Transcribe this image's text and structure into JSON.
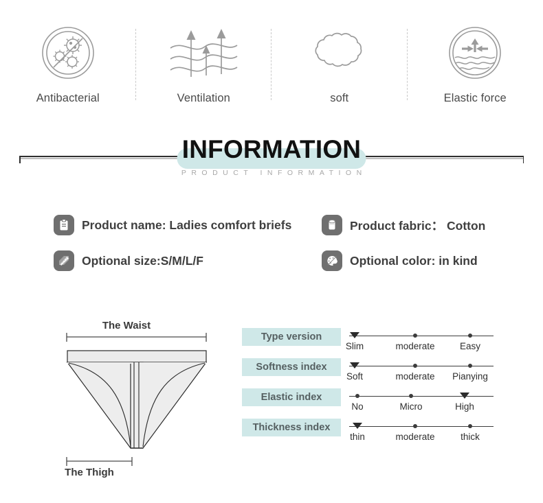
{
  "features": [
    {
      "label": "Antibacterial",
      "icon": "antibacterial-icon"
    },
    {
      "label": "Ventilation",
      "icon": "ventilation-icon"
    },
    {
      "label": "soft",
      "icon": "soft-cloud-icon"
    },
    {
      "label": "Elastic force",
      "icon": "elastic-force-icon"
    }
  ],
  "banner": {
    "title": "INFORMATION",
    "subtitle": "PRODUCT INFORMATION",
    "pill_color": "#cfe8e8"
  },
  "info": [
    {
      "icon": "clipboard-icon",
      "text": "Product name: Ladies comfort briefs"
    },
    {
      "icon": "ruler-icon",
      "text": "Optional size:S/M/L/F"
    },
    {
      "icon": "fabric-icon",
      "text": "Product fabric： Cotton"
    },
    {
      "icon": "palette-icon",
      "text": "Optional color: in kind"
    }
  ],
  "garment": {
    "waist_label": "The  Waist",
    "thigh_label": "The Thigh"
  },
  "scales": {
    "label_color": "#cfe8e8",
    "rows": [
      {
        "label": "Type version",
        "points": [
          {
            "label": "Slim",
            "marker": "triangle"
          },
          {
            "label": "moderate",
            "marker": "dot"
          },
          {
            "label": "Easy",
            "marker": "dot"
          }
        ]
      },
      {
        "label": "Softness index",
        "points": [
          {
            "label": "Soft",
            "marker": "triangle"
          },
          {
            "label": "moderate",
            "marker": "dot"
          },
          {
            "label": "Pianying",
            "marker": "dot"
          }
        ]
      },
      {
        "label": "Elastic index",
        "points": [
          {
            "label": "No",
            "marker": "dot"
          },
          {
            "label": "Micro",
            "marker": "dot"
          },
          {
            "label": "High",
            "marker": "triangle"
          }
        ]
      },
      {
        "label": "Thickness index",
        "points": [
          {
            "label": "thin",
            "marker": "triangle"
          },
          {
            "label": "moderate",
            "marker": "dot"
          },
          {
            "label": "thick",
            "marker": "dot"
          }
        ]
      }
    ]
  }
}
